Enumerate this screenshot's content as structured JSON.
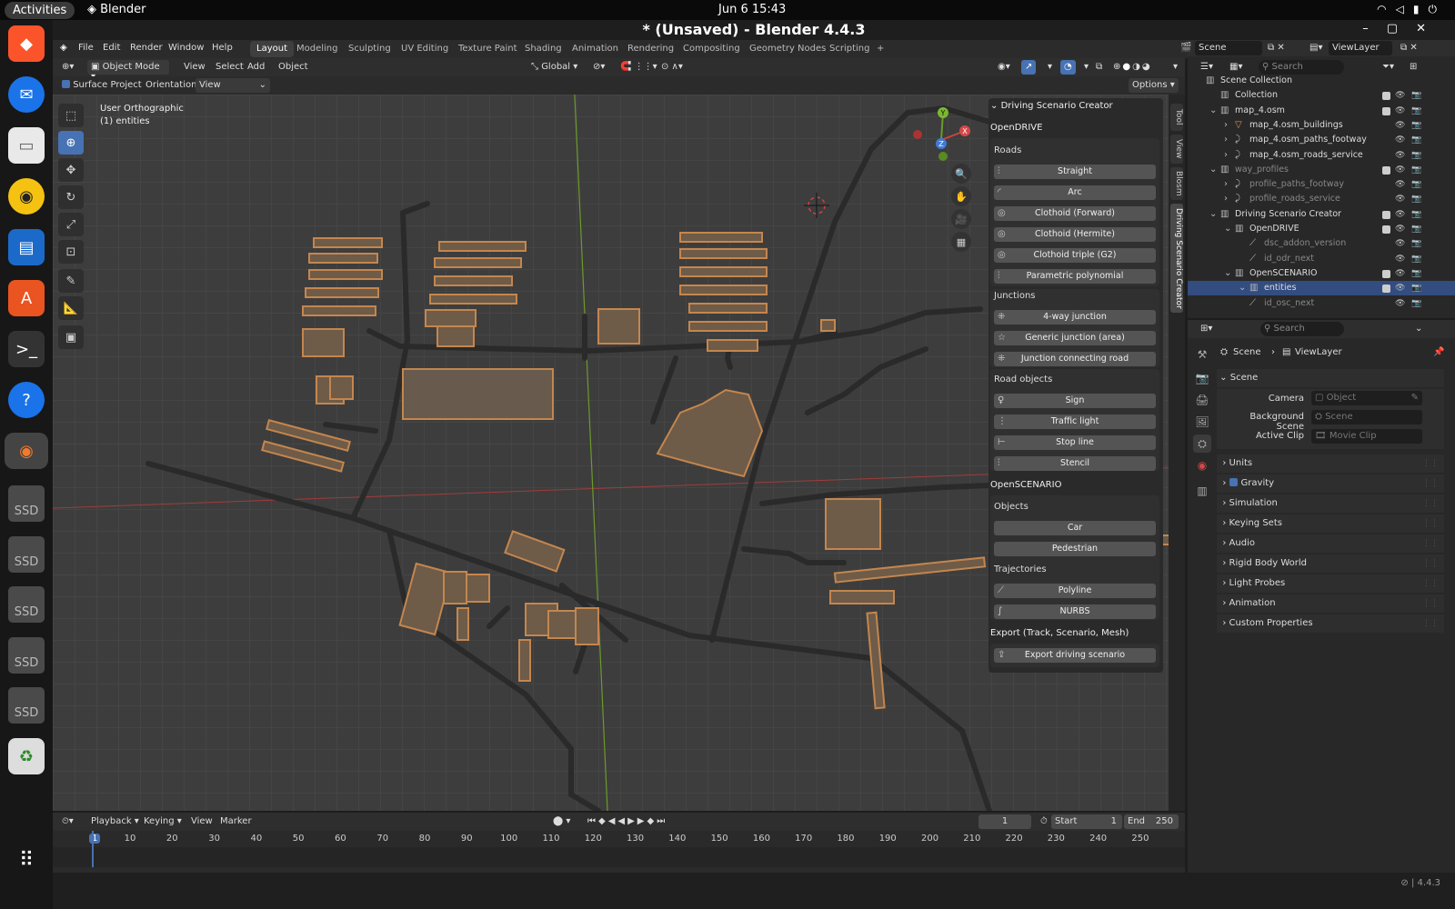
{
  "topbar": {
    "activities": "Activities",
    "app": "Blender",
    "clock": "Jun 6  15:43"
  },
  "window": {
    "title": "* (Unsaved) - Blender 4.4.3"
  },
  "menu": [
    "File",
    "Edit",
    "Render",
    "Window",
    "Help"
  ],
  "workspaces": [
    "Layout",
    "Modeling",
    "Sculpting",
    "UV Editing",
    "Texture Paint",
    "Shading",
    "Animation",
    "Rendering",
    "Compositing",
    "Geometry Nodes",
    "Scripting",
    "+"
  ],
  "viewport_header": {
    "mode": "Object Mode",
    "menus": [
      "View",
      "Select",
      "Add",
      "Object"
    ],
    "transform": "Global"
  },
  "tool_header": {
    "surface_project": "Surface Project",
    "orientation_label": "Orientation:",
    "orientation_value": "View",
    "options": "Options"
  },
  "viewport": {
    "info1": "User Orthographic",
    "info2": "(1) entities",
    "gizmo": {
      "x": "X",
      "y": "Y",
      "z": "Z"
    }
  },
  "npanel": {
    "header": "Driving Scenario Creator",
    "opendrive": "OpenDRIVE",
    "roads_title": "Roads",
    "roads": [
      "Straight",
      "Arc",
      "Clothoid (Forward)",
      "Clothoid (Hermite)",
      "Clothoid triple (G2)",
      "Parametric polynomial"
    ],
    "junctions_title": "Junctions",
    "junctions": [
      "4-way junction",
      "Generic junction (area)",
      "Junction connecting road"
    ],
    "objects_road_title": "Road objects",
    "road_objects": [
      "Sign",
      "Traffic light",
      "Stop line",
      "Stencil"
    ],
    "openscenario": "OpenSCENARIO",
    "objects_title": "Objects",
    "objects": [
      "Car",
      "Pedestrian"
    ],
    "traj_title": "Trajectories",
    "trajectories": [
      "Polyline",
      "NURBS"
    ],
    "export_title": "Export (Track, Scenario, Mesh)",
    "export_btn": "Export driving scenario"
  },
  "vtabs": [
    "Tool",
    "View",
    "Blosm",
    "Driving Scenario Creator"
  ],
  "outliner": {
    "scene": "Scene",
    "viewlayer": "ViewLayer",
    "search": "Search",
    "rows": [
      {
        "label": "Scene Collection",
        "indent": 0,
        "dim": false
      },
      {
        "label": "Collection",
        "indent": 1,
        "dim": false
      },
      {
        "label": "map_4.osm",
        "indent": 1,
        "dim": false
      },
      {
        "label": "map_4.osm_buildings",
        "indent": 2,
        "dim": false
      },
      {
        "label": "map_4.osm_paths_footway",
        "indent": 2,
        "dim": false
      },
      {
        "label": "map_4.osm_roads_service",
        "indent": 2,
        "dim": false
      },
      {
        "label": "way_profiles",
        "indent": 1,
        "dim": true
      },
      {
        "label": "profile_paths_footway",
        "indent": 2,
        "dim": true
      },
      {
        "label": "profile_roads_service",
        "indent": 2,
        "dim": true
      },
      {
        "label": "Driving Scenario Creator",
        "indent": 1,
        "dim": false
      },
      {
        "label": "OpenDRIVE",
        "indent": 2,
        "dim": false
      },
      {
        "label": "dsc_addon_version",
        "indent": 3,
        "dim": true
      },
      {
        "label": "id_odr_next",
        "indent": 3,
        "dim": true
      },
      {
        "label": "OpenSCENARIO",
        "indent": 2,
        "dim": false
      },
      {
        "label": "entities",
        "indent": 3,
        "dim": false
      },
      {
        "label": "id_osc_next",
        "indent": 3,
        "dim": true
      }
    ]
  },
  "props": {
    "search": "Search",
    "crumb_scene": "Scene",
    "crumb_vl": "ViewLayer",
    "section": "Scene",
    "camera_label": "Camera",
    "camera_ph": "Object",
    "bg_label": "Background Scene",
    "bg_ph": "Scene",
    "clip_label": "Active Clip",
    "clip_ph": "Movie Clip",
    "panels": [
      "Units",
      "Gravity",
      "Simulation",
      "Keying Sets",
      "Audio",
      "Rigid Body World",
      "Light Probes",
      "Animation",
      "Custom Properties"
    ]
  },
  "timeline": {
    "menus": [
      "Playback",
      "Keying",
      "View",
      "Marker"
    ],
    "current": "1",
    "start_label": "Start",
    "start": "1",
    "end_label": "End",
    "end": "250",
    "ticks": [
      "1",
      "10",
      "20",
      "30",
      "40",
      "50",
      "60",
      "70",
      "80",
      "90",
      "100",
      "110",
      "120",
      "130",
      "140",
      "150",
      "160",
      "170",
      "180",
      "190",
      "200",
      "210",
      "220",
      "230",
      "240",
      "250"
    ]
  },
  "status": {
    "version": "4.4.3"
  },
  "colors": {
    "accent": "#4772b3",
    "building": "#c4864e",
    "road": "#2a2a2a"
  }
}
